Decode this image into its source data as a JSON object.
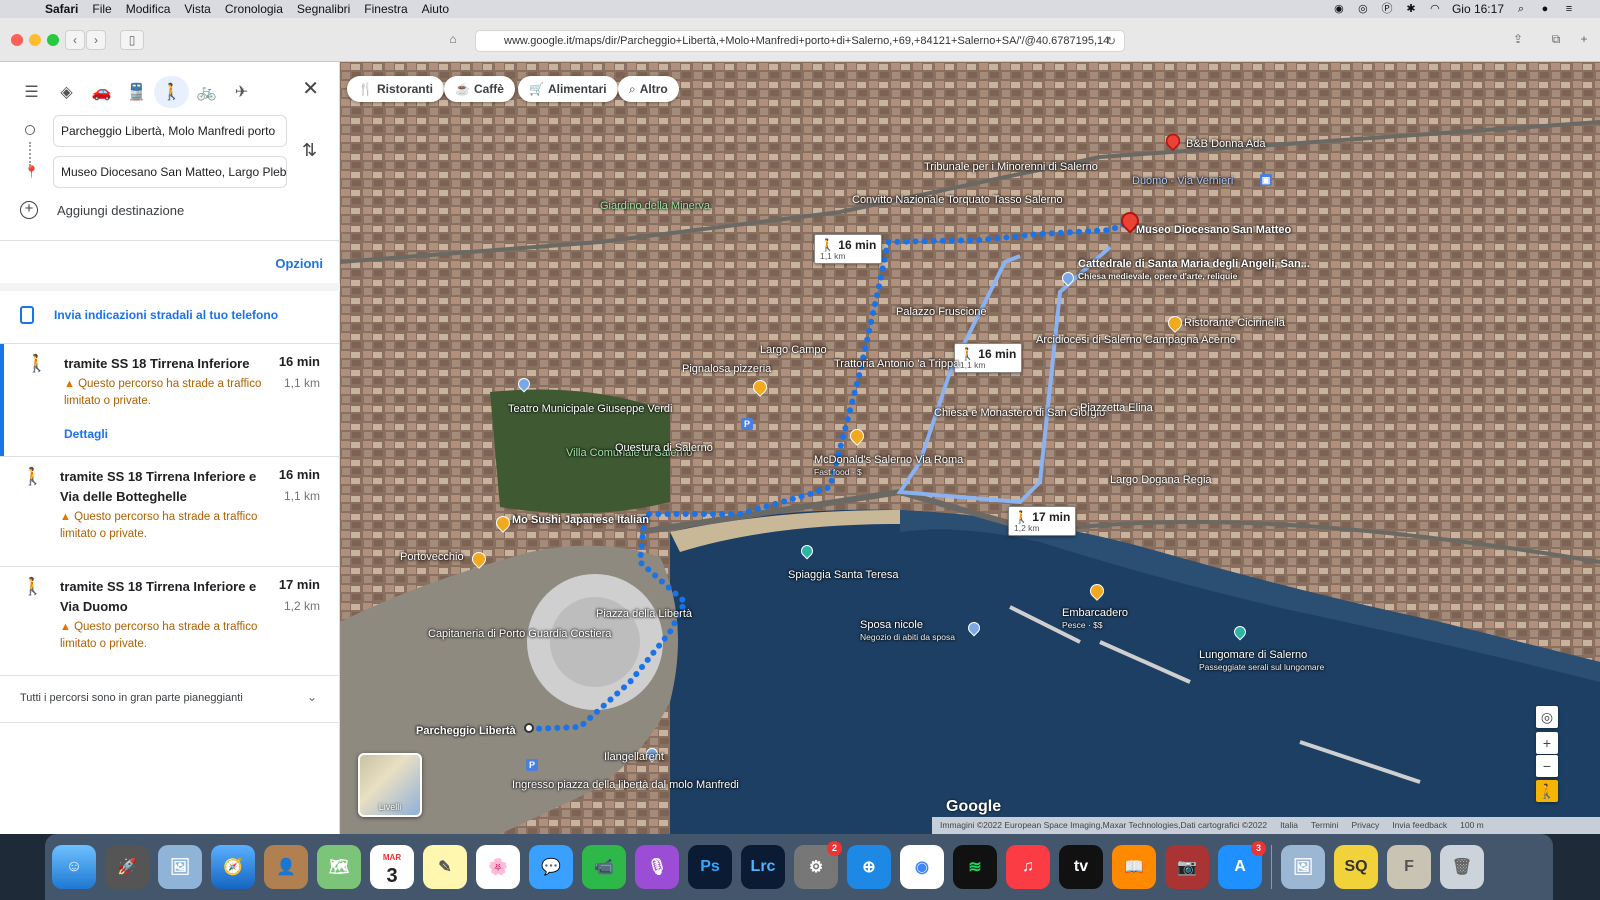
{
  "menubar": {
    "items": [
      "Safari",
      "File",
      "Modifica",
      "Vista",
      "Cronologia",
      "Segnalibri",
      "Finestra",
      "Aiuto"
    ],
    "clock": "Gio 16:17"
  },
  "browser": {
    "url": "www.google.it/maps/dir/Parcheggio+Libertà,+Molo+Manfredi+porto+di+Salerno,+69,+84121+Salerno+SA/'/@40.6787195,14"
  },
  "directions": {
    "origin": "Parcheggio Libertà, Molo Manfredi porto",
    "destination": "Museo Diocesano San Matteo, Largo Plebiscito",
    "add_destination": "Aggiungi destinazione",
    "options": "Opzioni",
    "send_to_phone": "Invia indicazioni stradali al tuo telefono",
    "routes": [
      {
        "title": "tramite SS 18 Tirrena Inferiore",
        "time": "16 min",
        "distance": "1,1 km",
        "warning": "Questo percorso ha strade a traffico limitato o private.",
        "details": "Dettagli"
      },
      {
        "title": "tramite SS 18 Tirrena Inferiore e Via delle Botteghelle",
        "time": "16 min",
        "distance": "1,1 km",
        "warning": "Questo percorso ha strade a traffico limitato o private."
      },
      {
        "title": "tramite SS 18 Tirrena Inferiore e Via Duomo",
        "time": "17 min",
        "distance": "1,2 km",
        "warning": "Questo percorso ha strade a traffico limitato o private."
      }
    ],
    "flat_note": "Tutti i percorsi sono in gran parte pianeggianti"
  },
  "map": {
    "chips": [
      "Ristoranti",
      "Caffè",
      "Alimentari",
      "Altro"
    ],
    "callouts": [
      {
        "time": "16 min",
        "dist": "1,1 km"
      },
      {
        "time": "16 min",
        "dist": "1,1 km"
      },
      {
        "time": "17 min",
        "dist": "1,2 km"
      }
    ],
    "labels": {
      "museo": "Museo Diocesano San Matteo",
      "cattedrale": "Cattedrale di Santa Maria degli Angeli, San...",
      "cattedrale_sub": "Chiesa medievale, opere d'arte, reliquie",
      "parcheggio": "Parcheggio Libertà",
      "piazza_liberta": "Piazza della Libertà",
      "spiaggia": "Spiaggia Santa Teresa",
      "lungomare": "Lungomare di Salerno",
      "lungomare_sub": "Passeggiate serali sul lungomare",
      "embarcadero": "Embarcadero",
      "embarcadero_sub": "Pesce · $$",
      "villa": "Villa Comunale di Salerno",
      "teatro": "Teatro Municipale Giuseppe Verdi",
      "questura": "Questura di Salerno",
      "mcdonalds": "McDonald's Salerno Via Roma",
      "mcdonalds_sub": "Fast food · $",
      "convitto": "Convitto Nazionale Torquato Tasso Salerno",
      "arcidiocesi": "Arcidiocesi di Salerno Campagna Acerno",
      "bb": "B&B Donna Ada",
      "giardino": "Giardino della Minerva",
      "chiesa_giorgio": "Chiesa e Monastero di San Giorgio",
      "piazzetta_elina": "Piazzetta Elina",
      "largo_dogana": "Largo Dogana Regia",
      "mo_sushi": "Mo Sushi Japanese Italian",
      "sposa": "Sposa nicole",
      "sposa_sub": "Negozio di abiti da sposa",
      "ristorante_cicirinella": "Ristorante Cicirinella",
      "trattoria": "Trattoria Antonio 'a Trippa",
      "palazzo": "Palazzo Fruscione",
      "tribunale": "Tribunale per i Minorenni di Salerno",
      "duomo": "Duomo - Via Vernieri",
      "portovecchio": "Portovecchio",
      "capitaneria": "Capitaneria di Porto Guardia Costiera",
      "ingresso": "Ingresso piazza della libertà dal molo Manfredi",
      "ilangellarent": "Ilangellarent",
      "pignalosa": "Pignalosa pizzeria",
      "largo_campo": "Largo Campo"
    },
    "layers_label": "Livelli",
    "google": "Google",
    "attribution": [
      "Immagini ©2022 European Space Imaging,Maxar Technologies,Dati cartografici ©2022",
      "Italia",
      "Termini",
      "Privacy",
      "Invia feedback",
      "100 m"
    ]
  },
  "dock": {
    "apps": [
      "Finder",
      "Launchpad",
      "Anteprima",
      "Safari",
      "Contatti",
      "Mappe",
      "Calendario",
      "Note",
      "Foto",
      "Messaggi",
      "FaceTime",
      "Podcast",
      "Photoshop",
      "Lightroom Classic",
      "Preferenze di Sistema",
      "Screen Share",
      "Chrome",
      "Spotify",
      "Musica",
      "Apple TV",
      "Libri",
      "Photo Booth",
      "App Store",
      "Anteprima immagini",
      "SQ",
      "Font Book",
      "Cestino"
    ],
    "calendar_month": "MAR",
    "calendar_day": "3",
    "badges": {
      "preferences": "2",
      "appstore": "3"
    }
  }
}
